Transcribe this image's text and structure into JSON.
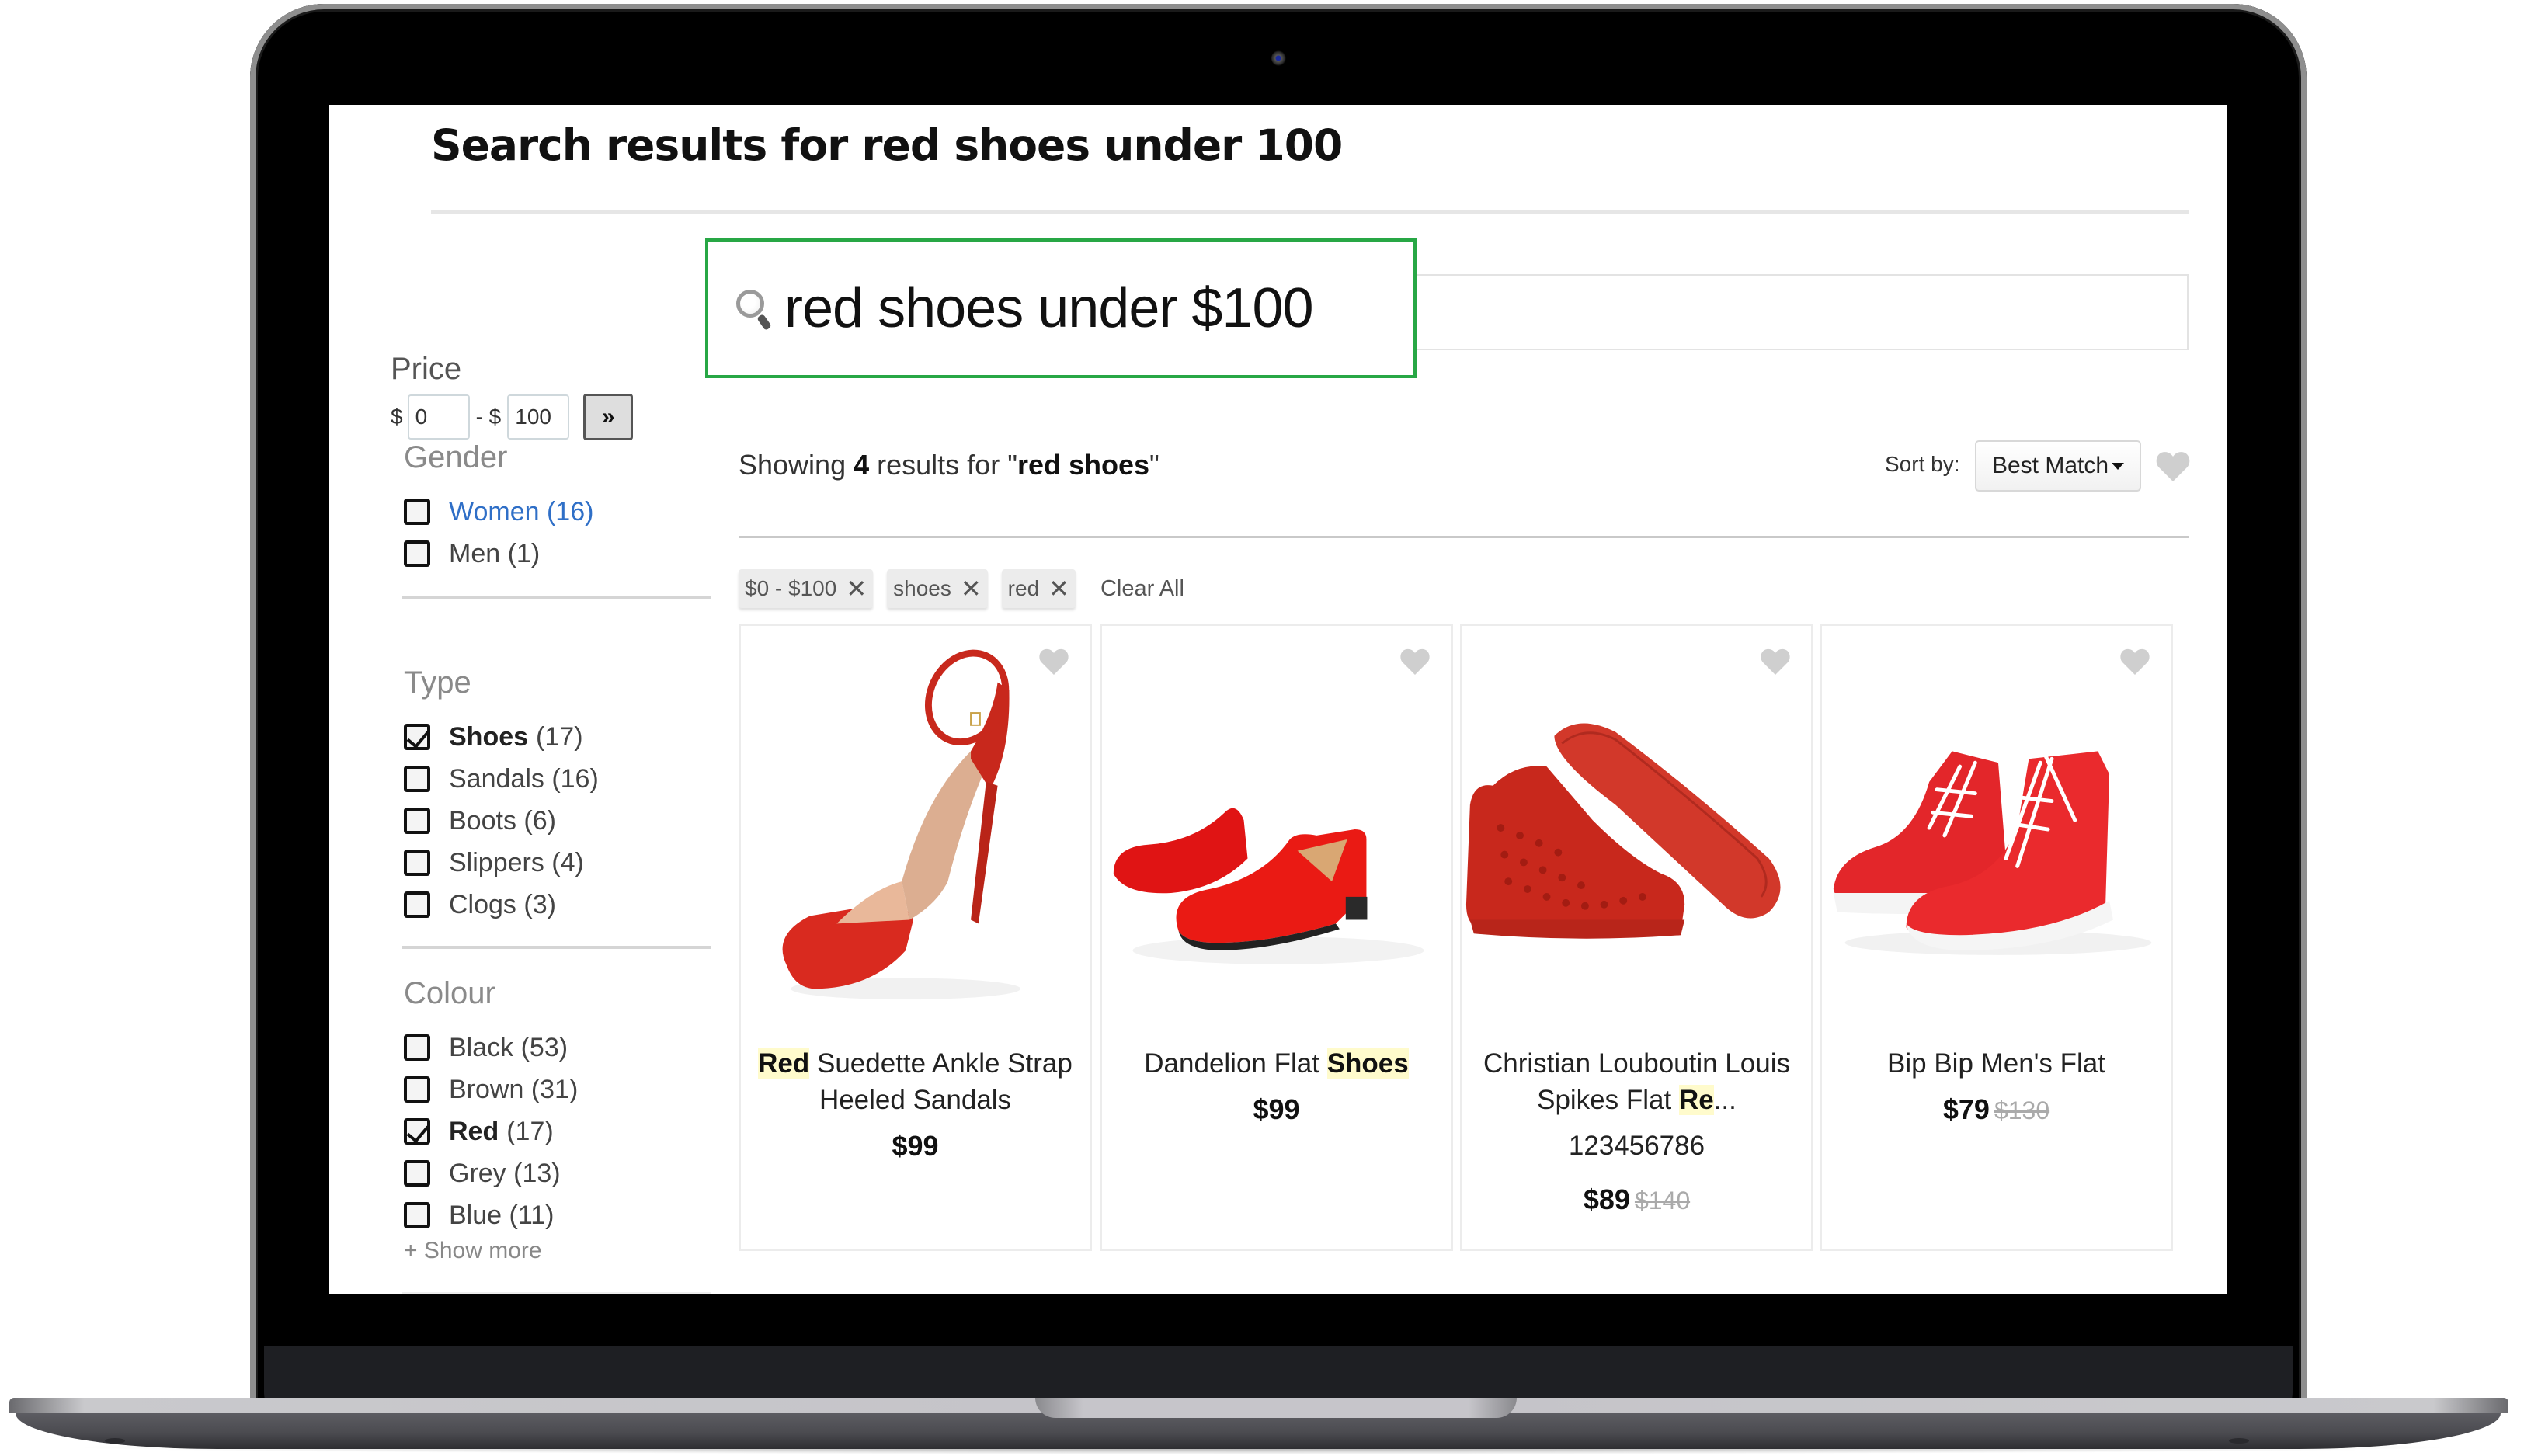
{
  "page": {
    "title": "Search results for red shoes under 100"
  },
  "search": {
    "query": "red shoes under $100",
    "highlight_color": "#28a745"
  },
  "sidebar": {
    "price": {
      "heading": "Price",
      "currency": "$",
      "separator": "- $",
      "min": "0",
      "max": "100",
      "go_label": "»"
    },
    "gender": {
      "heading": "Gender",
      "options": [
        {
          "label": "Women (16)",
          "checked": false,
          "style": "link"
        },
        {
          "label": "Men (1)",
          "checked": false,
          "style": "normal"
        }
      ]
    },
    "type": {
      "heading": "Type",
      "options": [
        {
          "label": "Shoes",
          "count": "(17)",
          "checked": true
        },
        {
          "label": "Sandals (16)",
          "checked": false
        },
        {
          "label": "Boots (6)",
          "checked": false
        },
        {
          "label": "Slippers (4)",
          "checked": false
        },
        {
          "label": "Clogs (3)",
          "checked": false
        }
      ]
    },
    "colour": {
      "heading": "Colour",
      "options": [
        {
          "label": "Black (53)",
          "checked": false
        },
        {
          "label": "Brown (31)",
          "checked": false
        },
        {
          "label": "Red",
          "count": "(17)",
          "checked": true
        },
        {
          "label": "Grey (13)",
          "checked": false
        },
        {
          "label": "Blue (11)",
          "checked": false
        }
      ],
      "show_more": "+ Show more"
    }
  },
  "results": {
    "prefix": "Showing ",
    "count": "4",
    "middle": " results for \"",
    "term": "red shoes",
    "suffix": "\"",
    "sort_label": "Sort by:",
    "sort_value": "Best Match",
    "chips": [
      {
        "label": "$0 - $100",
        "close": "✕"
      },
      {
        "label": "shoes",
        "close": "✕"
      },
      {
        "label": "red",
        "close": "✕"
      }
    ],
    "clear_all": "Clear All"
  },
  "products": [
    {
      "image": "red-ankle-strap-heeled-sandal",
      "name_hl": "Red",
      "name_rest": " Suedette Ankle Strap Heeled Sandals",
      "price": "$99"
    },
    {
      "image": "red-velvet-loafers",
      "name_pre": "Dandelion Flat ",
      "name_hl": "Shoes",
      "price": "$99"
    },
    {
      "image": "red-spiked-high-top-sneaker",
      "name_pre": "Christian Louboutin Louis Spikes Flat ",
      "name_hl": "Re",
      "name_ellipsis": "...",
      "sku": "123456786",
      "price": "$89",
      "old_price": "$140"
    },
    {
      "image": "red-leather-high-top-sneaker",
      "name_pre": "Bip Bip Men's Flat",
      "price": "$79",
      "old_price": "$130"
    }
  ]
}
